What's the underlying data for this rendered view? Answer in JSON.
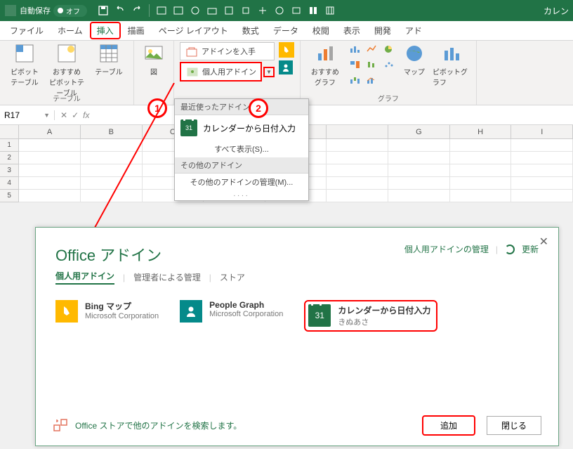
{
  "titlebar": {
    "autosave": "自動保存",
    "autosave_state": "オフ",
    "doc_title": "カレン"
  },
  "tabs": {
    "file": "ファイル",
    "home": "ホーム",
    "insert": "挿入",
    "draw": "描画",
    "page_layout": "ページ レイアウト",
    "formulas": "数式",
    "data": "データ",
    "review": "校閲",
    "view": "表示",
    "developer": "開発",
    "addins_tab": "アド"
  },
  "ribbon": {
    "group_table": "テーブル",
    "pivot_table": "ピボット\nテーブル",
    "recommended_pivot": "おすすめ\nピボットテーブル",
    "table": "テーブル",
    "illustrations": "図",
    "get_addins": "アドインを入手",
    "my_addins": "個人用アドイン",
    "recommended_charts": "おすすめ\nグラフ",
    "group_chart": "グラフ",
    "maps": "マップ",
    "pivot_chart": "ピボットグラフ"
  },
  "callouts": {
    "c1": "1",
    "c2": "2"
  },
  "namebox": {
    "value": "R17"
  },
  "columns": [
    "A",
    "B",
    "C",
    "",
    "",
    "",
    "G",
    "H",
    "I"
  ],
  "rows": [
    "1",
    "2",
    "3",
    "4",
    "5"
  ],
  "dropdown": {
    "recent_header": "最近使ったアドイン",
    "calendar_addin": "カレンダーから日付入力",
    "show_all": "すべて表示(S)...",
    "other_header": "その他のアドイン",
    "manage_other": "その他のアドインの管理(M)...",
    "cal_day": "31"
  },
  "dialog": {
    "title": "Office アドイン",
    "manage_link": "個人用アドインの管理",
    "refresh": "更新",
    "tab_my": "個人用アドイン",
    "tab_admin": "管理者による管理",
    "tab_store": "ストア",
    "addins": {
      "bing": {
        "title": "Bing マップ",
        "sub": "Microsoft Corporation"
      },
      "people": {
        "title": "People Graph",
        "sub": "Microsoft Corporation"
      },
      "calendar": {
        "title": "カレンダーから日付入力",
        "sub": "きぬあさ",
        "day": "31"
      }
    },
    "footer_text": "Office ストアで他のアドインを検索します。",
    "btn_add": "追加",
    "btn_close": "閉じる"
  }
}
